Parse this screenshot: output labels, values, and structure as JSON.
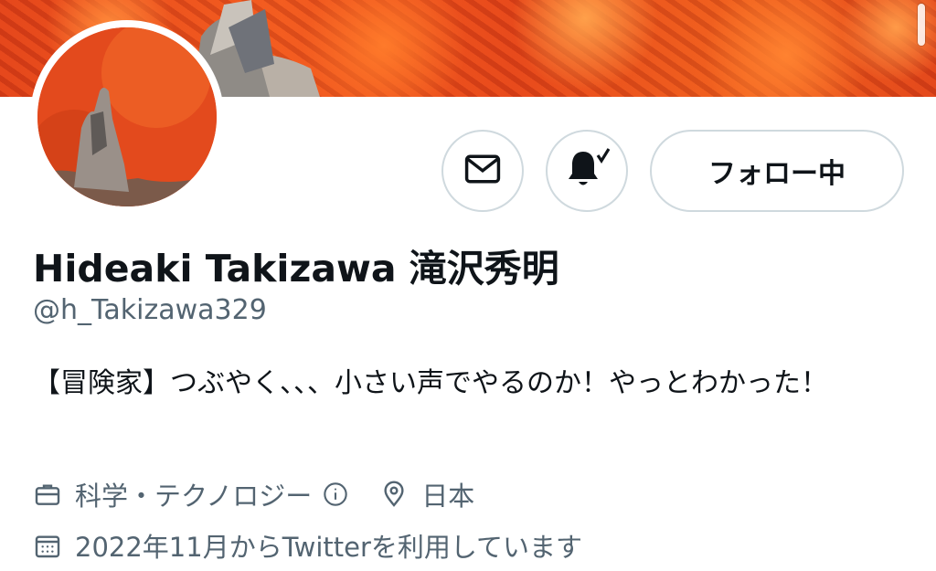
{
  "profile": {
    "display_name": "Hideaki Takizawa 滝沢秀明",
    "handle": "@h_Takizawa329",
    "bio": "【冒険家】つぶやく、、、小さい声でやるのか！やっとわかった！",
    "category": "科学・テクノロジー",
    "location": "日本",
    "joined": "2022年11月からTwitterを利用しています"
  },
  "actions": {
    "follow_label": "フォロー中"
  },
  "icons": {
    "message": "envelope-icon",
    "notify": "bell-check-icon",
    "category": "briefcase-icon",
    "info": "info-icon",
    "location": "location-pin-icon",
    "joined": "calendar-icon"
  },
  "colors": {
    "banner": "#e84a1c",
    "text": "#0f1419",
    "muted": "#536471",
    "border": "#cfd9de"
  }
}
